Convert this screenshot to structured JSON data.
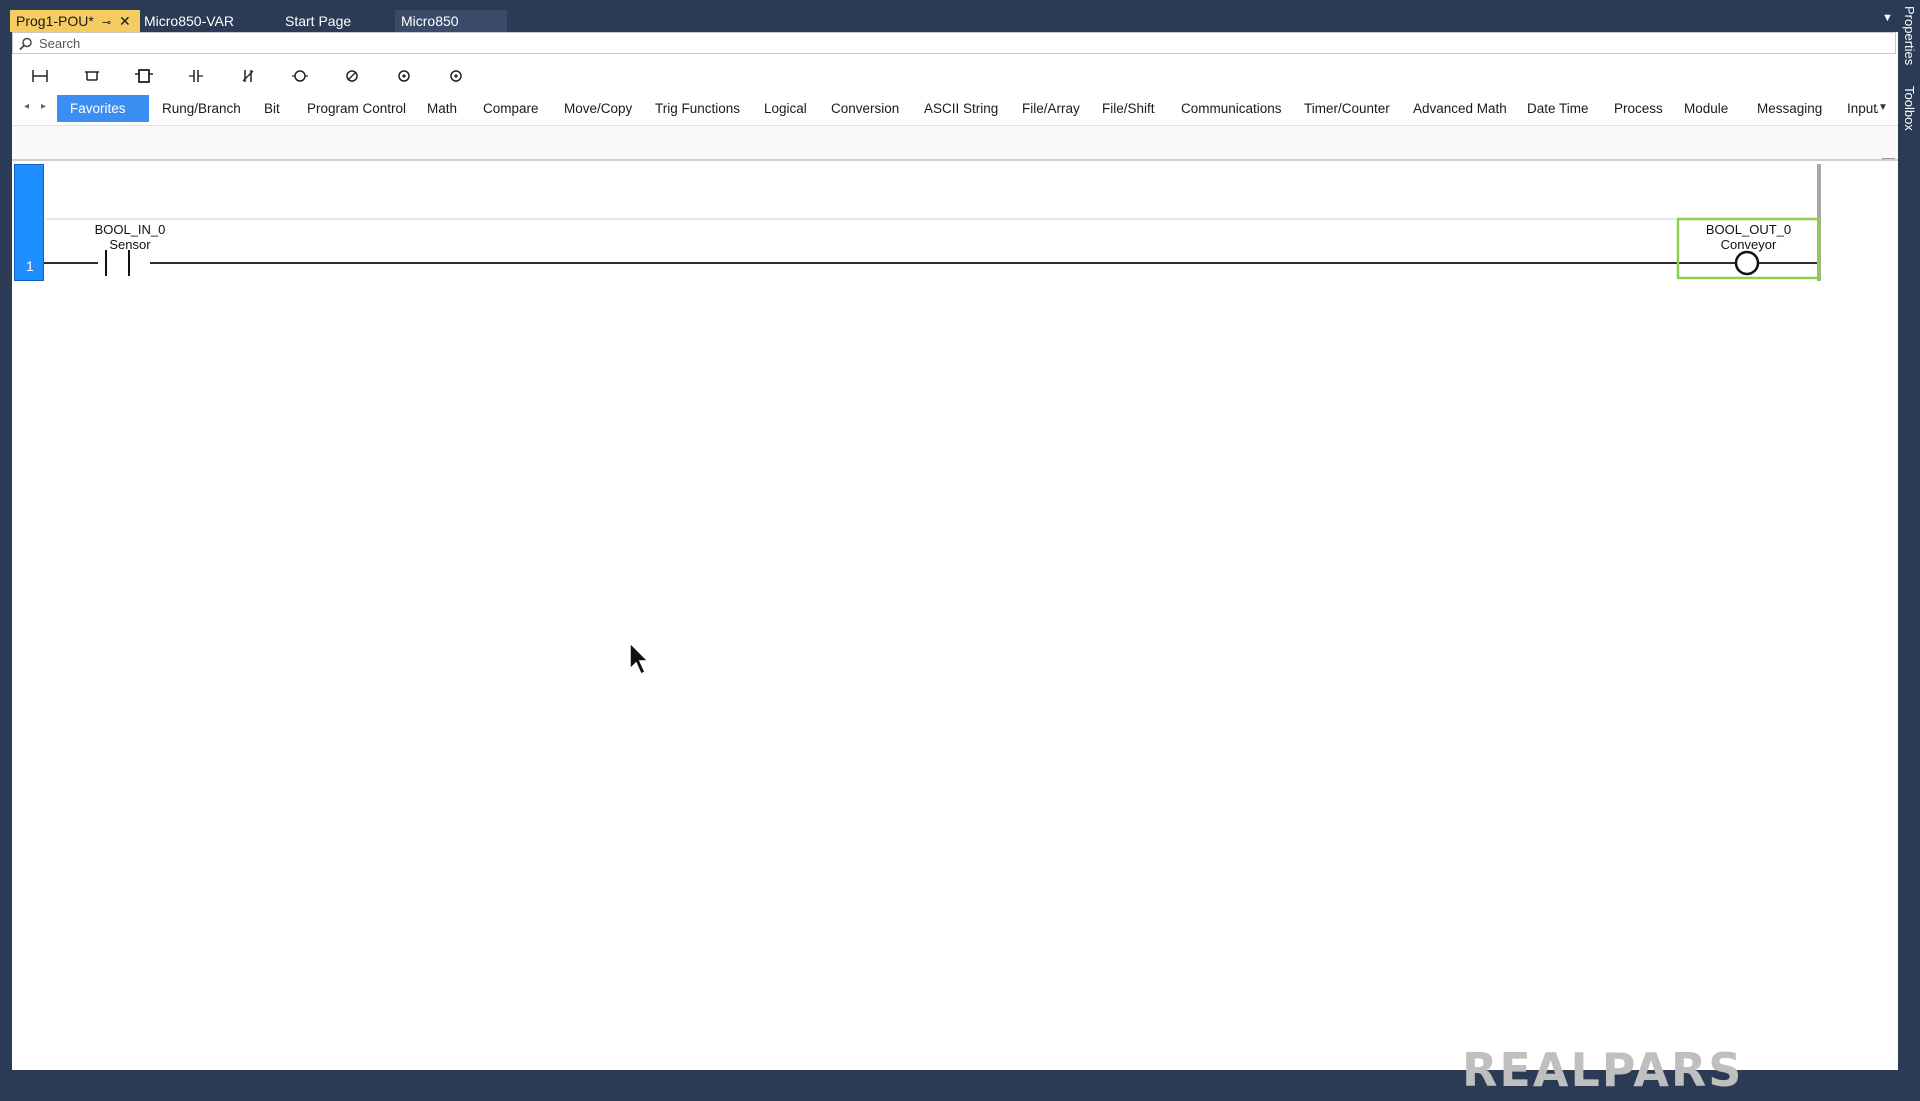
{
  "tabs": [
    {
      "label": "Prog1-POU*",
      "active": true
    },
    {
      "label": "Micro850-VAR",
      "active": false
    },
    {
      "label": "Start Page",
      "active": false
    },
    {
      "label": "Micro850",
      "active": false
    }
  ],
  "side_panels": [
    "Properties",
    "Toolbox"
  ],
  "search": {
    "placeholder": "Search"
  },
  "toolbar": [
    "rung-icon",
    "branch-icon",
    "block-icon",
    "contact-icon",
    "negated-contact-icon",
    "coil-icon",
    "negated-coil-icon",
    "set-coil-icon",
    "reset-coil-icon"
  ],
  "categories": [
    "Favorites",
    "Rung/Branch",
    "Bit",
    "Program Control",
    "Math",
    "Compare",
    "Move/Copy",
    "Trig Functions",
    "Logical",
    "Conversion",
    "ASCII String",
    "File/Array",
    "File/Shift",
    "Communications",
    "Timer/Counter",
    "Advanced Math",
    "Date Time",
    "Process",
    "Module",
    "Messaging",
    "Input/("
  ],
  "active_category": "Favorites",
  "rung": {
    "number": "1",
    "contact": {
      "variable": "BOOL_IN_0",
      "alias": "Sensor"
    },
    "coil": {
      "variable": "BOOL_OUT_0",
      "alias": "Conveyor"
    }
  },
  "colors": {
    "active_tab": "#f5cc62",
    "active_category": "#3b8ff2",
    "rung_number": "#1f8fff",
    "selection": "#8ad14a",
    "chrome": "#2b3a55"
  },
  "watermark": "REALPARS"
}
